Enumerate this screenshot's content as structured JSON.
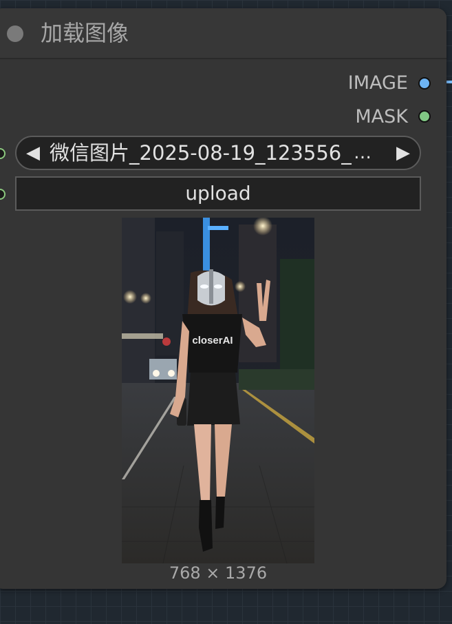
{
  "node": {
    "title": "加载图像",
    "outputs": [
      {
        "label": "IMAGE",
        "color": "#6db3f2"
      },
      {
        "label": "MASK",
        "color": "#81c784"
      }
    ],
    "image_combo": {
      "left_arrow": "◀",
      "right_arrow": "▶",
      "value": "微信图片_2025-08-19_123556_",
      "ellipsis": "…"
    },
    "upload_button": "upload",
    "preview": {
      "shirt_text": "closerAI",
      "dimensions": "768 × 1376"
    }
  }
}
